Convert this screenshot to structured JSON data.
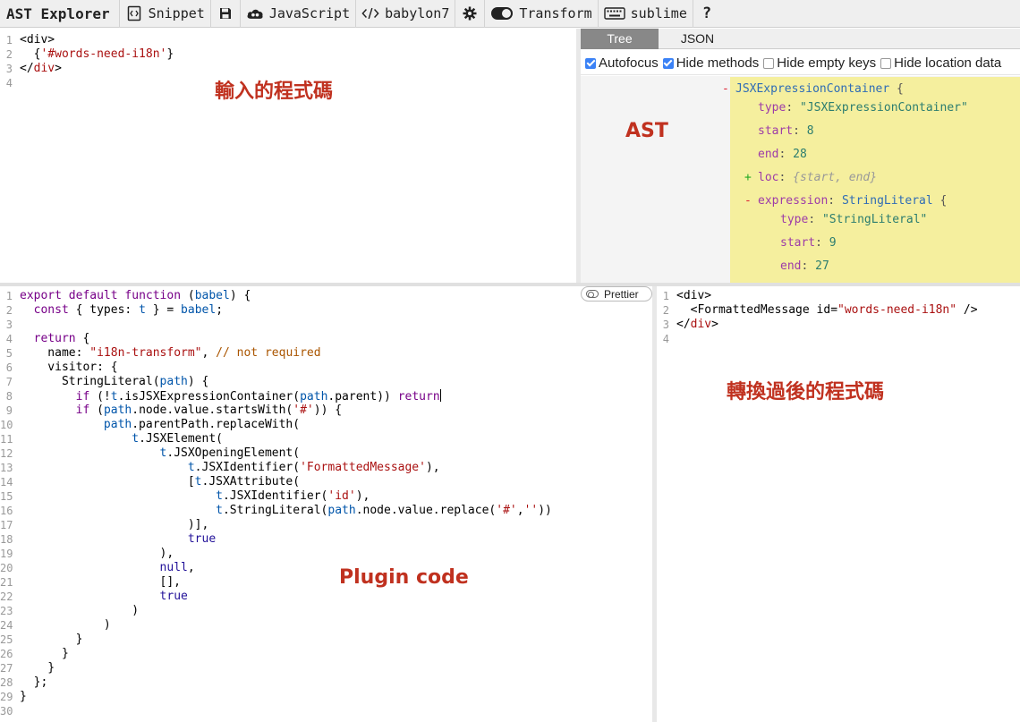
{
  "toolbar": {
    "title": "AST Explorer",
    "snippet": "Snippet",
    "language": "JavaScript",
    "parser": "babylon7",
    "transform": "Transform",
    "keymap": "sublime",
    "help": "?"
  },
  "tabs": {
    "tree": "Tree",
    "json": "JSON"
  },
  "options": {
    "autofocus": "Autofocus",
    "hide_methods": "Hide methods",
    "hide_empty_keys": "Hide empty keys",
    "hide_location_data": "Hide location data"
  },
  "annotations": {
    "input": "輸入的程式碼",
    "ast": "AST",
    "plugin": "Plugin code",
    "output": "轉換過後的程式碼"
  },
  "prettier": "Prettier",
  "source_lines": [
    [
      [
        "<div>",
        "tk-plain"
      ]
    ],
    [
      [
        "  {",
        "tk-plain"
      ],
      [
        "'#words-need-i18n'",
        "tk-str"
      ],
      [
        "}",
        "tk-plain"
      ]
    ],
    [
      [
        "</",
        "tk-plain"
      ],
      [
        "div",
        "tk-tag2"
      ],
      [
        ">",
        "tk-plain"
      ]
    ],
    [
      [
        "",
        "tk-plain"
      ]
    ]
  ],
  "plugin_lines": [
    [
      [
        "export",
        "tk-kw"
      ],
      [
        " ",
        "tk-plain"
      ],
      [
        "default",
        "tk-kw"
      ],
      [
        " ",
        "tk-plain"
      ],
      [
        "function",
        "tk-kw"
      ],
      [
        " (",
        "tk-plain"
      ],
      [
        "babel",
        "tk-var"
      ],
      [
        ") {",
        "tk-plain"
      ]
    ],
    [
      [
        "  ",
        "tk-plain"
      ],
      [
        "const",
        "tk-kw"
      ],
      [
        " { types: ",
        "tk-plain"
      ],
      [
        "t",
        "tk-var"
      ],
      [
        " } = ",
        "tk-plain"
      ],
      [
        "babel",
        "tk-var"
      ],
      [
        ";",
        "tk-plain"
      ]
    ],
    [
      [
        "",
        "tk-plain"
      ]
    ],
    [
      [
        "  ",
        "tk-plain"
      ],
      [
        "return",
        "tk-kw"
      ],
      [
        " {",
        "tk-plain"
      ]
    ],
    [
      [
        "    name: ",
        "tk-plain"
      ],
      [
        "\"i18n-transform\"",
        "tk-str"
      ],
      [
        ", ",
        "tk-plain"
      ],
      [
        "// not required",
        "tk-com"
      ]
    ],
    [
      [
        "    visitor: {",
        "tk-plain"
      ]
    ],
    [
      [
        "      StringLiteral(",
        "tk-plain"
      ],
      [
        "path",
        "tk-var"
      ],
      [
        ") {",
        "tk-plain"
      ]
    ],
    [
      [
        "        ",
        "tk-plain"
      ],
      [
        "if",
        "tk-kw"
      ],
      [
        " (!",
        "tk-plain"
      ],
      [
        "t",
        "tk-var"
      ],
      [
        ".isJSXExpressionContainer(",
        "tk-plain"
      ],
      [
        "path",
        "tk-var"
      ],
      [
        ".parent)) ",
        "tk-plain"
      ],
      [
        "return",
        "tk-kw"
      ],
      [
        "|CURSOR|",
        "cursor"
      ]
    ],
    [
      [
        "        ",
        "tk-plain"
      ],
      [
        "if",
        "tk-kw"
      ],
      [
        " (",
        "tk-plain"
      ],
      [
        "path",
        "tk-var"
      ],
      [
        ".node.value.startsWith(",
        "tk-plain"
      ],
      [
        "'#'",
        "tk-str"
      ],
      [
        ")) {",
        "tk-plain"
      ]
    ],
    [
      [
        "            ",
        "tk-plain"
      ],
      [
        "path",
        "tk-var"
      ],
      [
        ".parentPath.replaceWith(",
        "tk-plain"
      ]
    ],
    [
      [
        "                ",
        "tk-plain"
      ],
      [
        "t",
        "tk-var"
      ],
      [
        ".JSXElement(",
        "tk-plain"
      ]
    ],
    [
      [
        "                    ",
        "tk-plain"
      ],
      [
        "t",
        "tk-var"
      ],
      [
        ".JSXOpeningElement(",
        "tk-plain"
      ]
    ],
    [
      [
        "                        ",
        "tk-plain"
      ],
      [
        "t",
        "tk-var"
      ],
      [
        ".JSXIdentifier(",
        "tk-plain"
      ],
      [
        "'FormattedMessage'",
        "tk-str"
      ],
      [
        "),",
        "tk-plain"
      ]
    ],
    [
      [
        "                        [",
        "tk-plain"
      ],
      [
        "t",
        "tk-var"
      ],
      [
        ".JSXAttribute(",
        "tk-plain"
      ]
    ],
    [
      [
        "                            ",
        "tk-plain"
      ],
      [
        "t",
        "tk-var"
      ],
      [
        ".JSXIdentifier(",
        "tk-plain"
      ],
      [
        "'id'",
        "tk-str"
      ],
      [
        "),",
        "tk-plain"
      ]
    ],
    [
      [
        "                            ",
        "tk-plain"
      ],
      [
        "t",
        "tk-var"
      ],
      [
        ".StringLiteral(",
        "tk-plain"
      ],
      [
        "path",
        "tk-var"
      ],
      [
        ".node.value.replace(",
        "tk-plain"
      ],
      [
        "'#'",
        "tk-str"
      ],
      [
        ",",
        "tk-plain"
      ],
      [
        "''",
        "tk-str"
      ],
      [
        "))",
        "tk-plain"
      ]
    ],
    [
      [
        "                        )],",
        "tk-plain"
      ]
    ],
    [
      [
        "                        ",
        "tk-plain"
      ],
      [
        "true",
        "tk-atom"
      ]
    ],
    [
      [
        "                    ),",
        "tk-plain"
      ]
    ],
    [
      [
        "                    ",
        "tk-plain"
      ],
      [
        "null",
        "tk-atom"
      ],
      [
        ",",
        "tk-plain"
      ]
    ],
    [
      [
        "                    [],",
        "tk-plain"
      ]
    ],
    [
      [
        "                    ",
        "tk-plain"
      ],
      [
        "true",
        "tk-atom"
      ]
    ],
    [
      [
        "                )",
        "tk-plain"
      ]
    ],
    [
      [
        "            )",
        "tk-plain"
      ]
    ],
    [
      [
        "        }",
        "tk-plain"
      ]
    ],
    [
      [
        "      }",
        "tk-plain"
      ]
    ],
    [
      [
        "    }",
        "tk-plain"
      ]
    ],
    [
      [
        "  };",
        "tk-plain"
      ]
    ],
    [
      [
        "}",
        "tk-plain"
      ]
    ],
    [
      [
        "",
        "tk-plain"
      ]
    ]
  ],
  "output_lines": [
    [
      [
        "<div>",
        "tk-plain"
      ]
    ],
    [
      [
        "  <FormattedMessage ",
        "tk-plain"
      ],
      [
        "id",
        "tk-plain"
      ],
      [
        "=",
        "tk-plain"
      ],
      [
        "\"words-need-i18n\"",
        "tk-str"
      ],
      [
        " />",
        "tk-plain"
      ]
    ],
    [
      [
        "</",
        "tk-plain"
      ],
      [
        "div",
        "tk-tag2"
      ],
      [
        ">",
        "tk-plain"
      ]
    ],
    [
      [
        "",
        "tk-plain"
      ]
    ]
  ],
  "ast_tree": [
    {
      "toggle": "-",
      "parts": [
        [
          "JSXExpressionContainer",
          "at"
        ],
        [
          " {",
          "ab"
        ]
      ]
    },
    {
      "parts": [
        [
          "type",
          "ak"
        ],
        [
          ": ",
          "ab"
        ],
        [
          "\"JSXExpressionContainer\"",
          "as"
        ]
      ]
    },
    {
      "parts": [
        [
          "start",
          "ak"
        ],
        [
          ": ",
          "ab"
        ],
        [
          "8",
          "an"
        ]
      ]
    },
    {
      "parts": [
        [
          "end",
          "ak"
        ],
        [
          ": ",
          "ab"
        ],
        [
          "28",
          "an"
        ]
      ]
    },
    {
      "toggle": "+",
      "parts": [
        [
          "loc",
          "ak"
        ],
        [
          ": ",
          "ab"
        ],
        [
          "{start, end}",
          "ai"
        ]
      ]
    },
    {
      "toggle": "-",
      "parts": [
        [
          "expression",
          "ak"
        ],
        [
          ": ",
          "ab"
        ],
        [
          "StringLiteral",
          "at"
        ],
        [
          " {",
          "ab"
        ]
      ]
    },
    {
      "parts": [
        [
          "type",
          "ak"
        ],
        [
          ": ",
          "ab"
        ],
        [
          "\"StringLiteral\"",
          "as"
        ]
      ]
    },
    {
      "parts": [
        [
          "start",
          "ak"
        ],
        [
          ": ",
          "ab"
        ],
        [
          "9",
          "an"
        ]
      ]
    },
    {
      "parts": [
        [
          "end",
          "ak"
        ],
        [
          ": ",
          "ab"
        ],
        [
          "27",
          "an"
        ]
      ]
    }
  ]
}
